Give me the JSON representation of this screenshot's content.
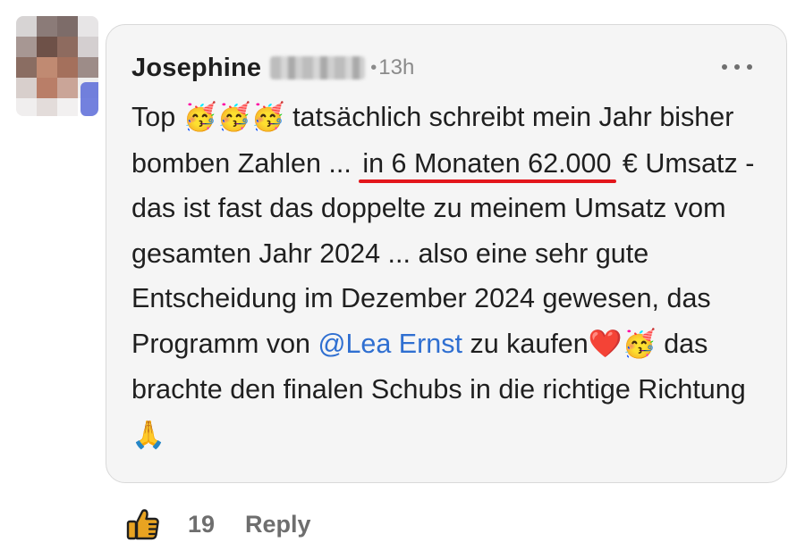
{
  "comment": {
    "author_name": "Josephine",
    "dot": "•",
    "timestamp": "13h",
    "text": {
      "part1": "Top ",
      "emoji_party": "🥳",
      "part2": " tatsächlich schreibt mein Jahr bisher bomben Zahlen ... ",
      "highlight": "in 6 Monaten 62.000",
      "part3": " € Umsatz - das ist fast das doppelte zu meinem Umsatz vom gesamten Jahr 2024 ... also eine sehr gute Entscheidung im Dezember 2024 gewesen, das Programm von ",
      "mention": "@Lea Ernst",
      "part4": " zu kaufen",
      "emoji_heart": "❤️",
      "part5": " das brachte den finalen Schubs in die richtige Richtung ",
      "emoji_pray": "🙏"
    },
    "like_count": "19",
    "reply_label": "Reply"
  },
  "icons": {
    "more": "more-horizontal-icon",
    "like": "thumbs-up-icon"
  },
  "colors": {
    "bubble_bg": "#f5f5f5",
    "mention": "#2f6fd1",
    "underline": "#e3161b",
    "like_icon": "#e8a321"
  }
}
